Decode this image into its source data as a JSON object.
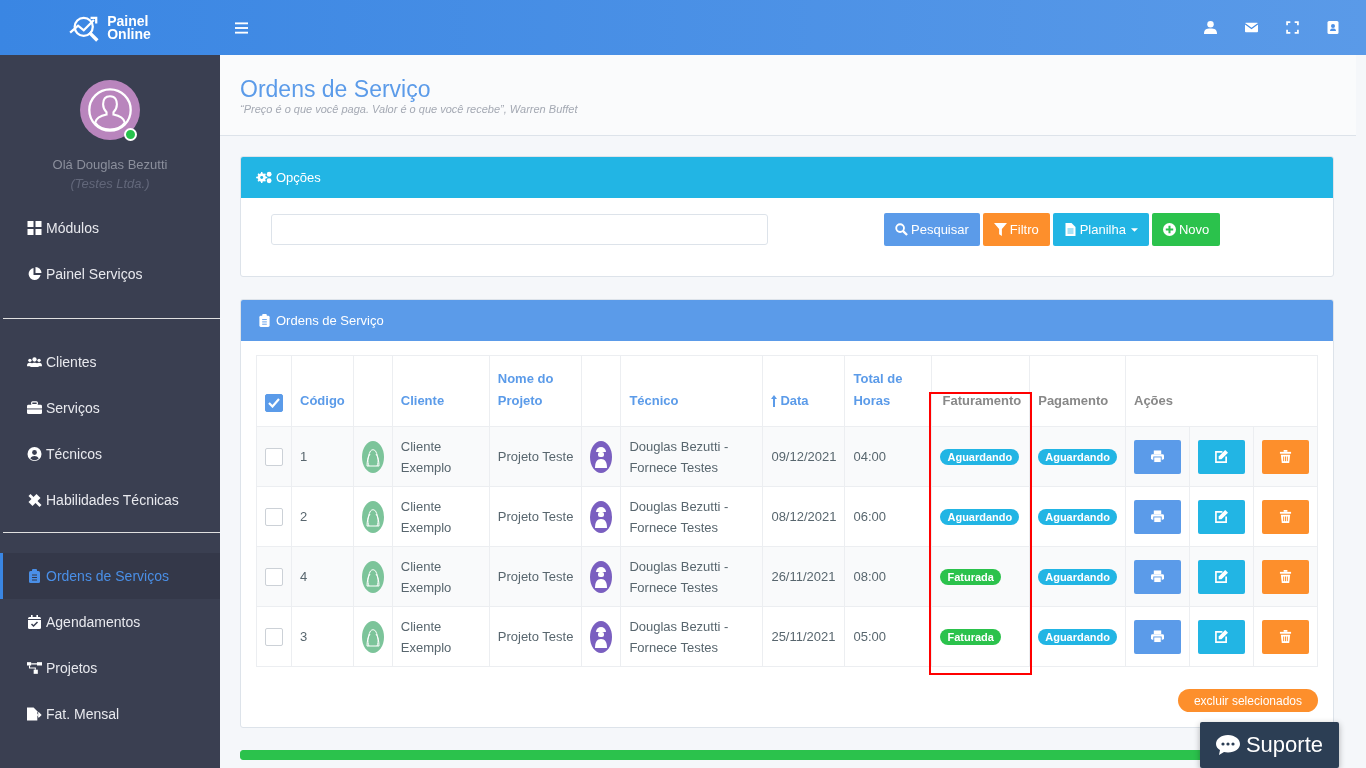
{
  "brand": {
    "line1": "Painel",
    "line2": "Online"
  },
  "user": {
    "greeting": "Olá Douglas Bezutti",
    "company": "(Testes Ltda.)",
    "online": true
  },
  "sidebar": {
    "groups": [
      [
        {
          "label": "Módulos",
          "selected": false
        },
        {
          "label": "Painel Serviços",
          "selected": false
        }
      ],
      [
        {
          "label": "Clientes",
          "selected": false
        },
        {
          "label": "Serviços",
          "selected": false
        },
        {
          "label": "Técnicos",
          "selected": false
        },
        {
          "label": "Habilidades Técnicas",
          "selected": false
        }
      ],
      [
        {
          "label": "Ordens de Serviços",
          "selected": true
        },
        {
          "label": "Agendamentos",
          "selected": false
        },
        {
          "label": "Projetos",
          "selected": false
        },
        {
          "label": "Fat. Mensal",
          "selected": false
        }
      ]
    ]
  },
  "page": {
    "title": "Ordens de Serviço",
    "quote": "“Preço é o que você paga. Valor é o que você recebe”, Warren Buffet"
  },
  "options_panel": {
    "title": "Opções",
    "buttons": [
      {
        "label": "Pesquisar",
        "kind": "search"
      },
      {
        "label": "Filtro",
        "kind": "filter"
      },
      {
        "label": "Planilha",
        "kind": "sheet"
      },
      {
        "label": "Novo",
        "kind": "new"
      }
    ]
  },
  "orders_panel": {
    "title": "Ordens de Serviço",
    "columns": [
      {
        "kind": "check"
      },
      {
        "label": "Código",
        "sortable": true
      },
      {
        "kind": "blank"
      },
      {
        "label": "Cliente",
        "sortable": true
      },
      {
        "label": "Nome do Projeto",
        "sortable": true
      },
      {
        "kind": "blank"
      },
      {
        "label": "Técnico",
        "sortable": true
      },
      {
        "label": "Data",
        "sortable": true,
        "sorted": true
      },
      {
        "label": "Total de Horas",
        "sortable": true
      },
      {
        "label": "Faturamento",
        "sortable": false,
        "highlighted": true
      },
      {
        "label": "Pagamento",
        "sortable": false
      },
      {
        "label": "Ações",
        "sortable": false,
        "kind": "actions"
      }
    ],
    "all_checked": true,
    "rows": [
      {
        "checked": false,
        "code": "1",
        "client": "Cliente Exemplo",
        "project": "Projeto Teste",
        "technician": "Douglas Bezutti - Fornece Testes",
        "date": "09/12/2021",
        "hours": "04:00",
        "billing": {
          "label": "Aguardando",
          "color": "#22b5e4"
        },
        "payment": {
          "label": "Aguardando",
          "color": "#22b5e4"
        }
      },
      {
        "checked": false,
        "code": "2",
        "client": "Cliente Exemplo",
        "project": "Projeto Teste",
        "technician": "Douglas Bezutti - Fornece Testes",
        "date": "08/12/2021",
        "hours": "06:00",
        "billing": {
          "label": "Aguardando",
          "color": "#22b5e4"
        },
        "payment": {
          "label": "Aguardando",
          "color": "#22b5e4"
        }
      },
      {
        "checked": false,
        "code": "4",
        "client": "Cliente Exemplo",
        "project": "Projeto Teste",
        "technician": "Douglas Bezutti - Fornece Testes",
        "date": "26/11/2021",
        "hours": "08:00",
        "billing": {
          "label": "Faturada",
          "color": "#2bc24c"
        },
        "payment": {
          "label": "Aguardando",
          "color": "#22b5e4"
        }
      },
      {
        "checked": false,
        "code": "3",
        "client": "Cliente Exemplo",
        "project": "Projeto Teste",
        "technician": "Douglas Bezutti - Fornece Testes",
        "date": "25/11/2021",
        "hours": "05:00",
        "billing": {
          "label": "Faturada",
          "color": "#2bc24c"
        },
        "payment": {
          "label": "Aguardando",
          "color": "#22b5e4"
        }
      }
    ],
    "delete_selected": "excluir selecionados"
  },
  "support": {
    "label": "Suporte"
  }
}
